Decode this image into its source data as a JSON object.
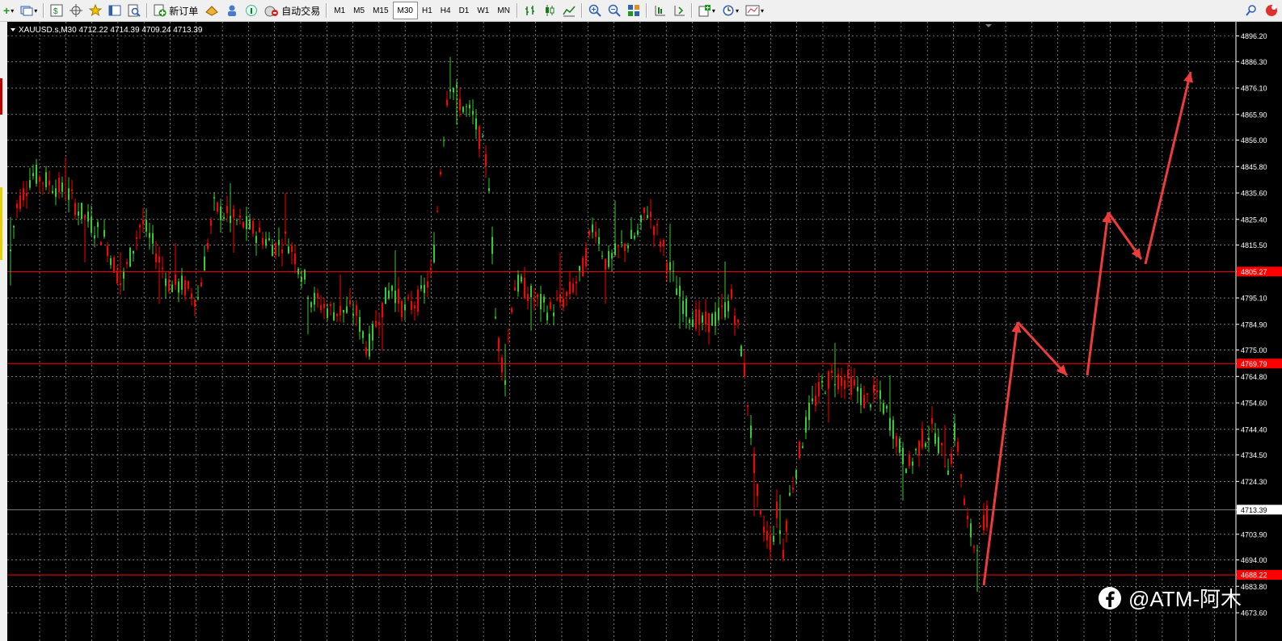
{
  "toolbar": {
    "new_order_label": "新订单",
    "autotrade_label": "自动交易",
    "timeframes": [
      "M1",
      "M5",
      "M15",
      "M30",
      "H1",
      "H4",
      "D1",
      "W1",
      "MN"
    ],
    "active_timeframe": "M30"
  },
  "chart": {
    "symbol_header": "XAUUSD.s,M30  4712.22 4714.39 4709.24 4713.39",
    "price_ticks": [
      "4896.20",
      "4886.30",
      "4876.10",
      "4865.90",
      "4856.00",
      "4845.80",
      "4835.60",
      "4825.40",
      "4815.50",
      "4805.27",
      "4795.10",
      "4784.90",
      "4775.00",
      "4769.79",
      "4764.80",
      "4754.60",
      "4744.40",
      "4734.50",
      "4724.30",
      "4713.39",
      "4703.90",
      "4694.00",
      "4688.22",
      "4683.80",
      "4673.60"
    ],
    "horizontal_lines": [
      {
        "price_label": "4805.27",
        "color": "#ff0000"
      },
      {
        "price_label": "4769.79",
        "color": "#ff0000"
      },
      {
        "price_label": "4688.22",
        "color": "#ff0000"
      }
    ],
    "current_price_label": "4713.39",
    "colors": {
      "background": "#000000",
      "bull": "#32cd32",
      "bear": "#ff0000",
      "arrow": "#ee3b3b",
      "grid": "#c0c0c0"
    }
  },
  "watermark": {
    "text": "@ATM-阿木"
  }
}
